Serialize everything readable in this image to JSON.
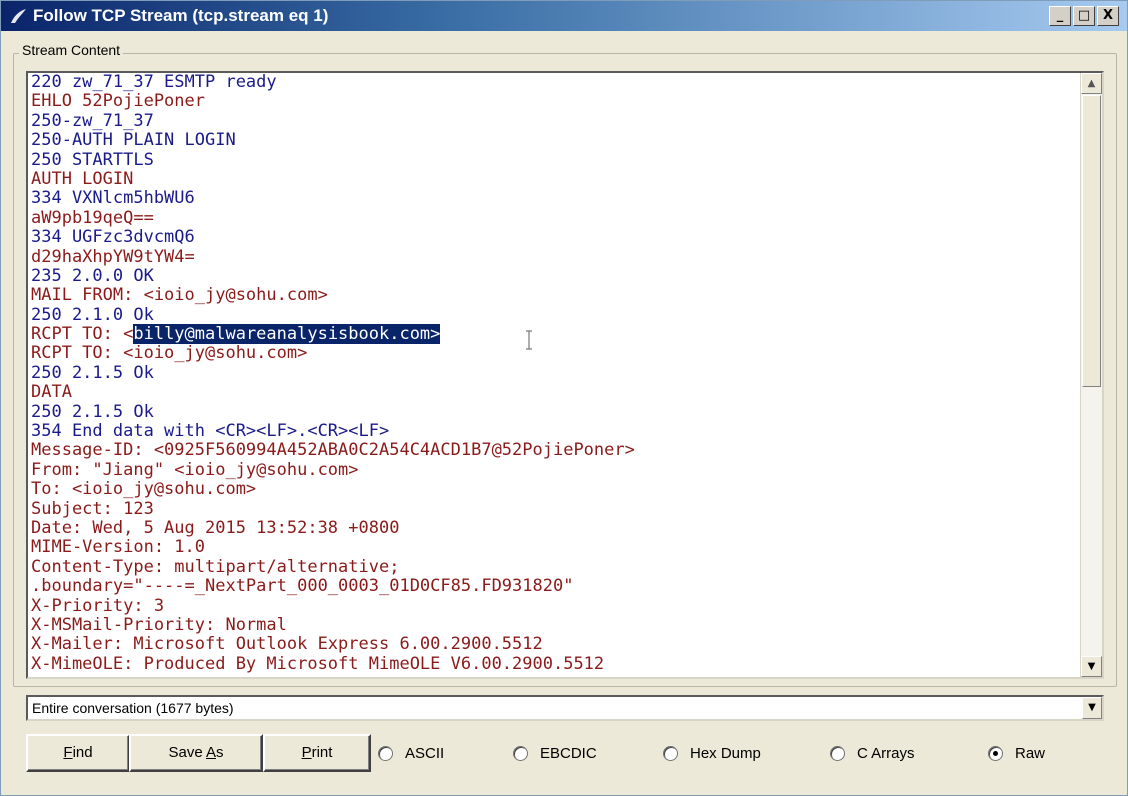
{
  "window": {
    "title": "Follow TCP Stream (tcp.stream eq 1)",
    "minimize_label": "_",
    "maximize_label": "□",
    "close_label": "X"
  },
  "group": {
    "label": "Stream Content"
  },
  "stream": {
    "lines": [
      {
        "text": "220 zw_71_37 ESMTP ready",
        "dir": "srv"
      },
      {
        "text": "EHLO 52PojiePoner",
        "dir": "cli"
      },
      {
        "text": "250-zw_71_37",
        "dir": "srv"
      },
      {
        "text": "250-AUTH PLAIN LOGIN",
        "dir": "srv"
      },
      {
        "text": "250 STARTTLS",
        "dir": "srv"
      },
      {
        "text": "AUTH LOGIN",
        "dir": "cli"
      },
      {
        "text": "334 VXNlcm5hbWU6",
        "dir": "srv"
      },
      {
        "text": "aW9pb19qeQ==",
        "dir": "cli"
      },
      {
        "text": "334 UGFzc3dvcmQ6",
        "dir": "srv"
      },
      {
        "text": "d29haXhpYW9tYW4=",
        "dir": "cli"
      },
      {
        "text": "235 2.0.0 OK",
        "dir": "srv"
      },
      {
        "text": "MAIL FROM: <ioio_jy@sohu.com>",
        "dir": "cli"
      },
      {
        "text": "250 2.1.0 Ok",
        "dir": "srv"
      },
      {
        "text": "RCPT TO: <",
        "dir": "cli",
        "sel": "billy@malwareanalysisbook.com>"
      },
      {
        "text": "RCPT TO: <ioio_jy@sohu.com>",
        "dir": "cli"
      },
      {
        "text": "250 2.1.5 Ok",
        "dir": "srv"
      },
      {
        "text": "DATA",
        "dir": "cli"
      },
      {
        "text": "250 2.1.5 Ok",
        "dir": "srv"
      },
      {
        "text": "354 End data with <CR><LF>.<CR><LF>",
        "dir": "srv"
      },
      {
        "text": "Message-ID: <0925F560994A452ABA0C2A54C4ACD1B7@52PojiePoner>",
        "dir": "cli"
      },
      {
        "text": "From: \"Jiang\" <ioio_jy@sohu.com>",
        "dir": "cli"
      },
      {
        "text": "To: <ioio_jy@sohu.com>",
        "dir": "cli"
      },
      {
        "text": "Subject: 123",
        "dir": "cli"
      },
      {
        "text": "Date: Wed, 5 Aug 2015 13:52:38 +0800",
        "dir": "cli"
      },
      {
        "text": "MIME-Version: 1.0",
        "dir": "cli"
      },
      {
        "text": "Content-Type: multipart/alternative;",
        "dir": "cli"
      },
      {
        "text": ".boundary=\"----=_NextPart_000_0003_01D0CF85.FD931820\"",
        "dir": "cli"
      },
      {
        "text": "X-Priority: 3",
        "dir": "cli"
      },
      {
        "text": "X-MSMail-Priority: Normal",
        "dir": "cli"
      },
      {
        "text": "X-Mailer: Microsoft Outlook Express 6.00.2900.5512",
        "dir": "cli"
      },
      {
        "text": "X-MimeOLE: Produced By Microsoft MimeOLE V6.00.2900.5512",
        "dir": "cli"
      }
    ]
  },
  "conversation": {
    "selected": "Entire conversation (1677 bytes)"
  },
  "buttons": {
    "find": {
      "pre": "",
      "u": "F",
      "post": "ind"
    },
    "save_as": {
      "pre": "Save ",
      "u": "A",
      "post": "s"
    },
    "print": {
      "pre": "",
      "u": "P",
      "post": "rint"
    }
  },
  "formats": [
    {
      "label": "ASCII",
      "checked": false
    },
    {
      "label": "EBCDIC",
      "checked": false
    },
    {
      "label": "Hex Dump",
      "checked": false
    },
    {
      "label": "C Arrays",
      "checked": false
    },
    {
      "label": "Raw",
      "checked": true
    }
  ],
  "colors": {
    "client_text": "#8b1a1a",
    "server_text": "#1a1a8b",
    "selection": "#0a246a"
  }
}
